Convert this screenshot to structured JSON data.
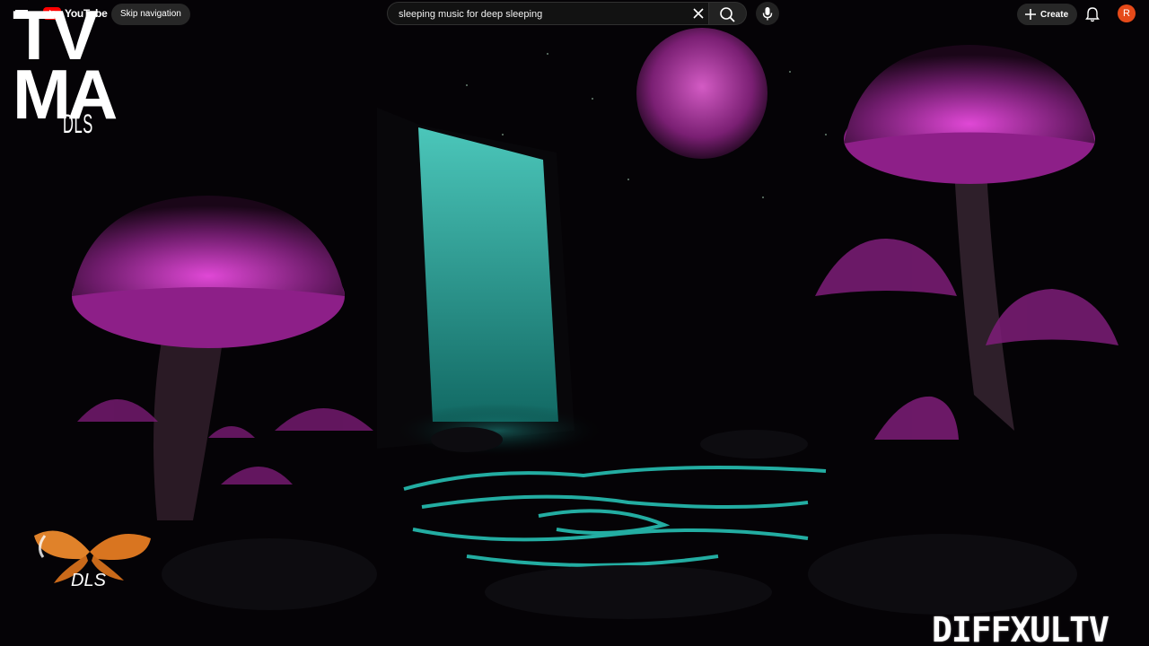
{
  "topbar": {
    "logo_text": "YouTube",
    "skip_label": "Skip navigation",
    "search_value": "sleeping music for deep sleeping",
    "create_label": "Create",
    "avatar_letter": "R"
  },
  "watermarks": {
    "top_left_big": "TV MA",
    "top_left_small": "DLS",
    "bottom_left": "DLS",
    "bottom_right": "DIFFXULTV"
  },
  "colors": {
    "mushroom": "#c02bb8",
    "water": "#2ee6d6",
    "moon": "#b63aa6",
    "youtube_red": "#ff0000"
  },
  "icons": [
    "menu-icon",
    "youtube-logo-icon",
    "close-icon",
    "search-icon",
    "mic-icon",
    "plus-icon",
    "bell-icon"
  ]
}
